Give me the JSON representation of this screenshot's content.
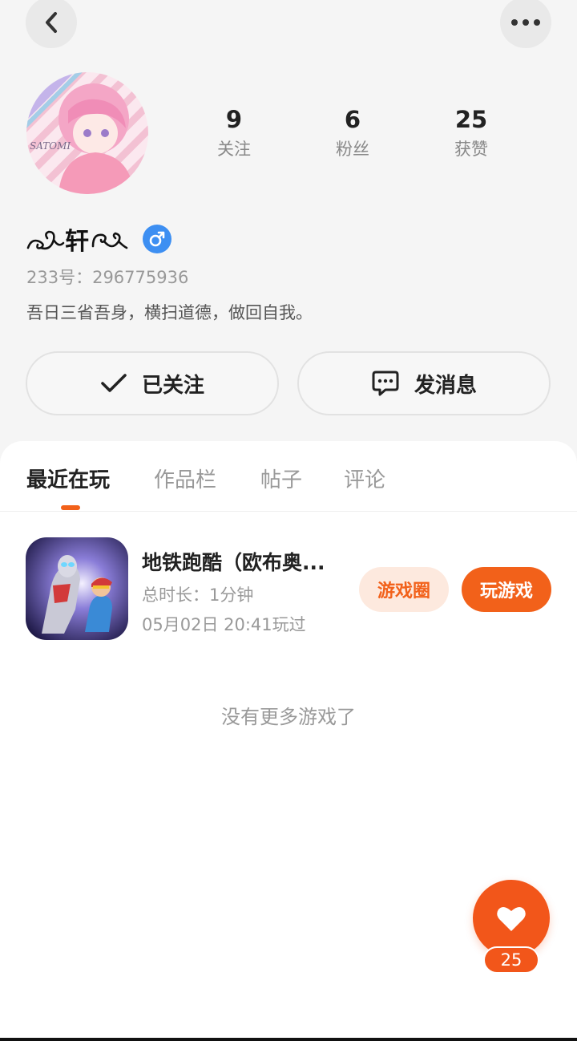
{
  "header": {
    "back_icon": "back-chevron-icon",
    "more_icon": "more-dots-icon"
  },
  "profile": {
    "avatar_text": "SATOMI",
    "nickname": "轩",
    "uid": "233号：296775936",
    "bio": "吾日三省吾身，横扫道德，做回自我。",
    "gender": "male",
    "stats": [
      {
        "num": "9",
        "label": "关注"
      },
      {
        "num": "6",
        "label": "粉丝"
      },
      {
        "num": "25",
        "label": "获赞"
      }
    ]
  },
  "actions": {
    "follow_label": "已关注",
    "message_label": "发消息"
  },
  "tabs": [
    {
      "label": "最近在玩",
      "active": true
    },
    {
      "label": "作品栏",
      "active": false
    },
    {
      "label": "帖子",
      "active": false
    },
    {
      "label": "评论",
      "active": false
    }
  ],
  "games": [
    {
      "title": "地铁跑酷（欧布奥...",
      "duration": "总时长：1分钟",
      "last_played": "05月02日 20:41玩过",
      "circle_label": "游戏圈",
      "play_label": "玩游戏"
    }
  ],
  "footer_text": "没有更多游戏了",
  "like": {
    "count": "25"
  },
  "colors": {
    "accent": "#f2611a",
    "gender_blue": "#3d8ff2"
  }
}
